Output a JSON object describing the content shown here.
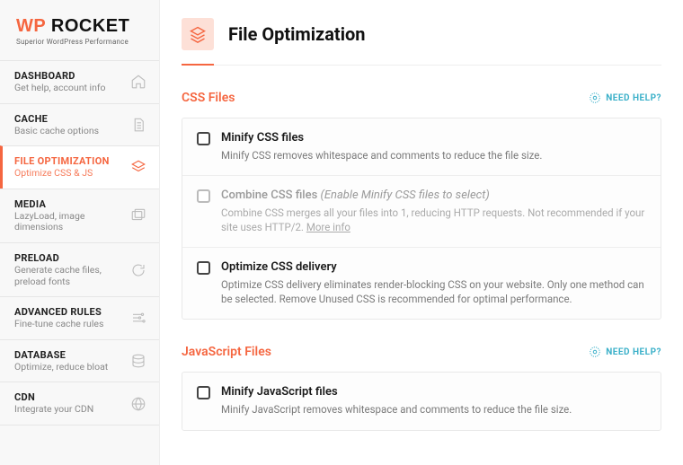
{
  "brand": {
    "wp": "WP",
    "rocket": "ROCKET",
    "tagline": "Superior WordPress Performance"
  },
  "nav": [
    {
      "title": "DASHBOARD",
      "sub": "Get help, account info"
    },
    {
      "title": "CACHE",
      "sub": "Basic cache options"
    },
    {
      "title": "FILE OPTIMIZATION",
      "sub": "Optimize CSS & JS"
    },
    {
      "title": "MEDIA",
      "sub": "LazyLoad, image dimensions"
    },
    {
      "title": "PRELOAD",
      "sub": "Generate cache files, preload fonts"
    },
    {
      "title": "ADVANCED RULES",
      "sub": "Fine-tune cache rules"
    },
    {
      "title": "DATABASE",
      "sub": "Optimize, reduce bloat"
    },
    {
      "title": "CDN",
      "sub": "Integrate your CDN"
    }
  ],
  "page": {
    "title": "File Optimization"
  },
  "help_label": "NEED HELP?",
  "sections": {
    "css": {
      "title": "CSS Files",
      "opts": [
        {
          "title": "Minify CSS files",
          "desc": "Minify CSS removes whitespace and comments to reduce the file size."
        },
        {
          "title": "Combine CSS files",
          "hint": "(Enable Minify CSS files to select)",
          "desc": "Combine CSS merges all your files into 1, reducing HTTP requests. Not recommended if your site uses HTTP/2.",
          "more": "More info"
        },
        {
          "title": "Optimize CSS delivery",
          "desc": "Optimize CSS delivery eliminates render-blocking CSS on your website. Only one method can be selected. Remove Unused CSS is recommended for optimal performance."
        }
      ]
    },
    "js": {
      "title": "JavaScript Files",
      "opts": [
        {
          "title": "Minify JavaScript files",
          "desc": "Minify JavaScript removes whitespace and comments to reduce the file size."
        }
      ]
    }
  }
}
